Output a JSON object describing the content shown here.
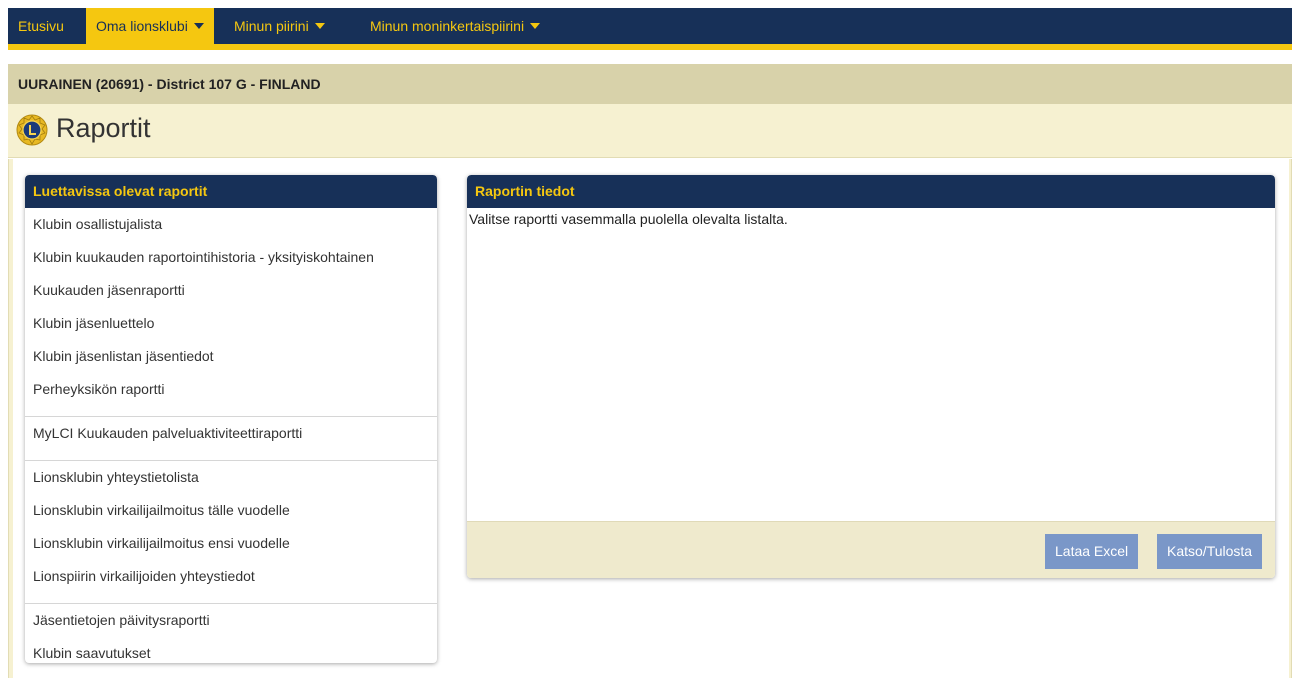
{
  "nav": {
    "items": [
      {
        "label": "Etusivu",
        "dropdown": false,
        "active": false
      },
      {
        "label": "Oma lionsklubi",
        "dropdown": true,
        "active": true
      },
      {
        "label": "Minun piirini",
        "dropdown": true,
        "active": false
      },
      {
        "label": "Minun moninkertaispiirini",
        "dropdown": true,
        "active": false
      }
    ]
  },
  "club": {
    "title": "UURAINEN (20691) - District 107 G - FINLAND"
  },
  "page": {
    "title": "Raportit",
    "logo_icon": "lions-club-logo"
  },
  "reports_panel": {
    "header": "Luettavissa olevat raportit",
    "groups": [
      [
        "Klubin osallistujalista",
        "Klubin kuukauden raportointihistoria - yksityiskohtainen",
        "Kuukauden jäsenraportti",
        "Klubin jäsenluettelo",
        "Klubin jäsenlistan jäsentiedot",
        "Perheyksikön raportti"
      ],
      [
        "MyLCI Kuukauden palveluaktiviteettiraportti"
      ],
      [
        "Lionsklubin yhteystietolista",
        "Lionsklubin virkailijailmoitus tälle vuodelle",
        "Lionsklubin virkailijailmoitus ensi vuodelle",
        "Lionspiirin virkailijoiden yhteystiedot"
      ],
      [
        "Jäsentietojen päivitysraportti",
        "Klubin saavutukset"
      ]
    ]
  },
  "details_panel": {
    "header": "Raportin tiedot",
    "body_text": "Valitse raportti vasemmalla puolella olevalta listalta.",
    "buttons": {
      "excel": "Lataa Excel",
      "print": "Katso/Tulosta"
    }
  },
  "colors": {
    "navy": "#173058",
    "gold": "#f5c710",
    "beige": "#f6f1d1",
    "club_bar": "#d8d2aa",
    "button": "#7a97c8"
  }
}
